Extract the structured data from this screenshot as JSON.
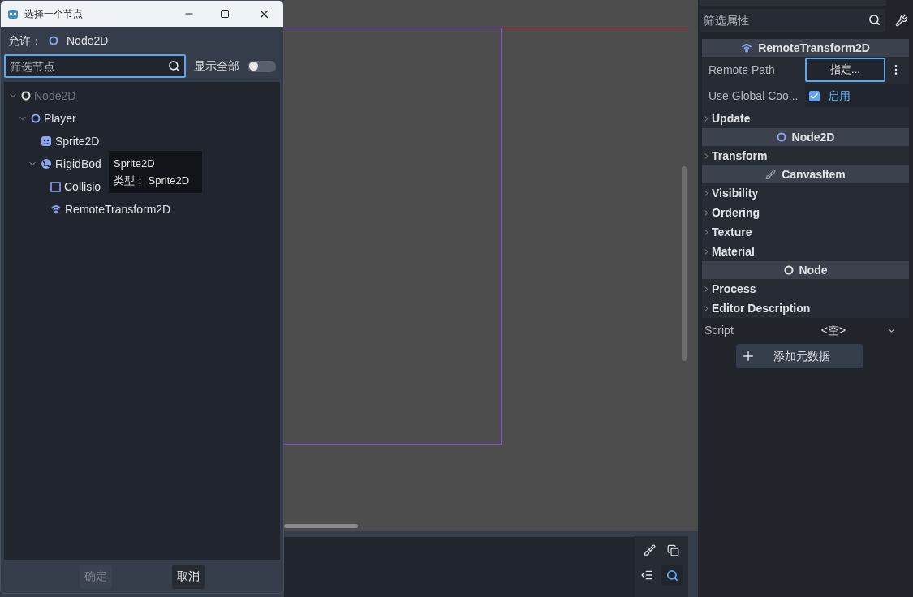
{
  "dialog": {
    "title": "选择一个节点",
    "allow_label": "允许：",
    "allow_type": "Node2D",
    "filter": {
      "placeholder": "筛选节点"
    },
    "show_all": {
      "label": "显示全部",
      "on": false
    },
    "tree": [
      {
        "label": "Node2D",
        "kind": "node",
        "disabled": true,
        "expanded": true,
        "children": [
          {
            "label": "Player",
            "kind": "node",
            "disabled": false,
            "expanded": true,
            "children": [
              {
                "label": "Sprite2D",
                "kind": "sprite",
                "disabled": false
              },
              {
                "label": "RigidBod",
                "kind": "body",
                "disabled": false,
                "expanded": true,
                "children": [
                  {
                    "label": "Collisio",
                    "kind": "shape",
                    "disabled": false
                  },
                  {
                    "label": "RemoteTransform2D",
                    "kind": "remote",
                    "disabled": false
                  }
                ]
              }
            ]
          }
        ]
      }
    ],
    "tooltip": [
      "Sprite2D",
      "类型： Sprite2D"
    ],
    "buttons": [
      {
        "label": "确定",
        "disabled": true
      },
      {
        "label": "取消",
        "disabled": false
      }
    ]
  },
  "inspector": {
    "filter": {
      "placeholder": "筛选属性"
    },
    "rows": [
      {
        "kind": "header",
        "label": "RemoteTransform2D"
      },
      {
        "kind": "path",
        "label": "Remote Path",
        "value": "指定..."
      },
      {
        "kind": "checkbox",
        "label": "Use Global Coo...",
        "value": "启用",
        "checked": true
      },
      {
        "kind": "group",
        "label": "Update"
      },
      {
        "kind": "header",
        "label": "Node2D"
      },
      {
        "kind": "group",
        "label": "Transform"
      },
      {
        "kind": "header",
        "label": "CanvasItem"
      },
      {
        "kind": "group",
        "label": "Visibility"
      },
      {
        "kind": "group",
        "label": "Ordering"
      },
      {
        "kind": "group",
        "label": "Texture"
      },
      {
        "kind": "group",
        "label": "Material"
      },
      {
        "kind": "header",
        "label": "Node"
      },
      {
        "kind": "group",
        "label": "Process"
      },
      {
        "kind": "group",
        "label": "Editor Description"
      },
      {
        "kind": "dropdown",
        "label": "Script",
        "value": "<空>"
      },
      {
        "kind": "add",
        "label": "添加元数据"
      }
    ]
  }
}
